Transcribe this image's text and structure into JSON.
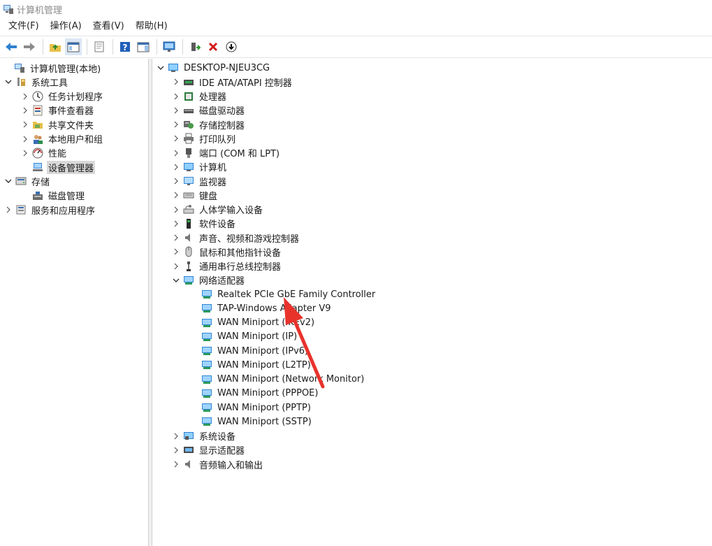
{
  "window": {
    "title": "计算机管理"
  },
  "menu": [
    "文件(F)",
    "操作(A)",
    "查看(V)",
    "帮助(H)"
  ],
  "toolbar": {
    "buttons": [
      "back-icon",
      "forward-icon",
      "up-folder-icon",
      "show-hide-tree-icon",
      "properties-icon",
      "help-icon",
      "action-pane-icon",
      "monitor-icon",
      "update-driver-icon",
      "uninstall-icon",
      "download-icon"
    ]
  },
  "left_tree": [
    {
      "label": "计算机管理(本地)",
      "icon": "computer-management-icon",
      "chevron": ""
    },
    {
      "label": "系统工具",
      "icon": "system-tools-icon",
      "chevron": "expanded"
    },
    {
      "label": "任务计划程序",
      "icon": "clock-icon",
      "chevron": "collapsed"
    },
    {
      "label": "事件查看器",
      "icon": "event-viewer-icon",
      "chevron": "collapsed"
    },
    {
      "label": "共享文件夹",
      "icon": "shared-folder-icon",
      "chevron": "collapsed"
    },
    {
      "label": "本地用户和组",
      "icon": "users-icon",
      "chevron": "collapsed"
    },
    {
      "label": "性能",
      "icon": "performance-icon",
      "chevron": "collapsed"
    },
    {
      "label": "设备管理器",
      "icon": "device-manager-icon",
      "chevron": "",
      "selected": true
    },
    {
      "label": "存储",
      "icon": "storage-icon",
      "chevron": "expanded"
    },
    {
      "label": "磁盘管理",
      "icon": "disk-management-icon",
      "chevron": ""
    },
    {
      "label": "服务和应用程序",
      "icon": "services-icon",
      "chevron": "collapsed"
    }
  ],
  "device_tree": {
    "root": "DESKTOP-NJEU3CG",
    "categories": [
      {
        "label": "IDE ATA/ATAPI 控制器",
        "icon": "ide-controller-icon"
      },
      {
        "label": "处理器",
        "icon": "processor-icon"
      },
      {
        "label": "磁盘驱动器",
        "icon": "disk-drive-icon"
      },
      {
        "label": "存储控制器",
        "icon": "storage-controller-icon"
      },
      {
        "label": "打印队列",
        "icon": "printer-icon"
      },
      {
        "label": "端口 (COM 和 LPT)",
        "icon": "port-icon"
      },
      {
        "label": "计算机",
        "icon": "computer-icon"
      },
      {
        "label": "监视器",
        "icon": "monitor-icon"
      },
      {
        "label": "键盘",
        "icon": "keyboard-icon"
      },
      {
        "label": "人体学输入设备",
        "icon": "hid-icon"
      },
      {
        "label": "软件设备",
        "icon": "software-device-icon"
      },
      {
        "label": "声音、视频和游戏控制器",
        "icon": "audio-icon"
      },
      {
        "label": "鼠标和其他指针设备",
        "icon": "mouse-icon"
      },
      {
        "label": "通用串行总线控制器",
        "icon": "usb-icon"
      }
    ],
    "network": {
      "label": "网络适配器",
      "icon": "network-adapter-icon",
      "children": [
        "Realtek PCIe GbE Family Controller",
        "TAP-Windows Adapter V9",
        "WAN Miniport (IKEv2)",
        "WAN Miniport (IP)",
        "WAN Miniport (IPv6)",
        "WAN Miniport (L2TP)",
        "WAN Miniport (Network Monitor)",
        "WAN Miniport (PPPOE)",
        "WAN Miniport (PPTP)",
        "WAN Miniport (SSTP)"
      ]
    },
    "after": [
      {
        "label": "系统设备",
        "icon": "system-device-icon"
      },
      {
        "label": "显示适配器",
        "icon": "display-adapter-icon"
      },
      {
        "label": "音频输入和输出",
        "icon": "audio-io-icon"
      }
    ]
  },
  "colors": {
    "accent_arrow": "#e8332b",
    "selection": "#d9d9d9"
  }
}
